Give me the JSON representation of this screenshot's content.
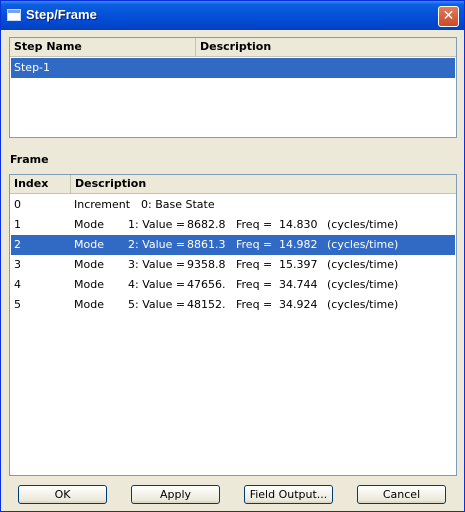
{
  "window": {
    "title": "Step/Frame",
    "close_glyph": "✕"
  },
  "step_table": {
    "columns": [
      "Step Name",
      "Description"
    ],
    "rows": [
      {
        "name": "Step-1",
        "description": "",
        "selected": true
      }
    ]
  },
  "frame_section": {
    "label": "Frame"
  },
  "frame_table": {
    "columns": [
      "Index",
      "Description"
    ],
    "rows": [
      {
        "index": "0",
        "type": "Increment",
        "desc": "0: Base State"
      },
      {
        "index": "1",
        "type": "Mode",
        "mode": "1: Value =",
        "value": "8682.8",
        "freq_label": "Freq =",
        "freq": "14.830",
        "unit": "(cycles/time)"
      },
      {
        "index": "2",
        "type": "Mode",
        "mode": "2: Value =",
        "value": "8861.3",
        "freq_label": "Freq =",
        "freq": "14.982",
        "unit": "(cycles/time)",
        "selected": true
      },
      {
        "index": "3",
        "type": "Mode",
        "mode": "3: Value =",
        "value": "9358.8",
        "freq_label": "Freq =",
        "freq": "15.397",
        "unit": "(cycles/time)"
      },
      {
        "index": "4",
        "type": "Mode",
        "mode": "4: Value =",
        "value": "47656.",
        "freq_label": "Freq =",
        "freq": "34.744",
        "unit": "(cycles/time)"
      },
      {
        "index": "5",
        "type": "Mode",
        "mode": "5: Value =",
        "value": "48152.",
        "freq_label": "Freq =",
        "freq": "34.924",
        "unit": "(cycles/time)"
      }
    ]
  },
  "buttons": {
    "ok": "OK",
    "apply": "Apply",
    "field_output": "Field Output...",
    "cancel": "Cancel"
  },
  "colors": {
    "selection": "#316ac5",
    "titlebar": "#0550d8"
  }
}
